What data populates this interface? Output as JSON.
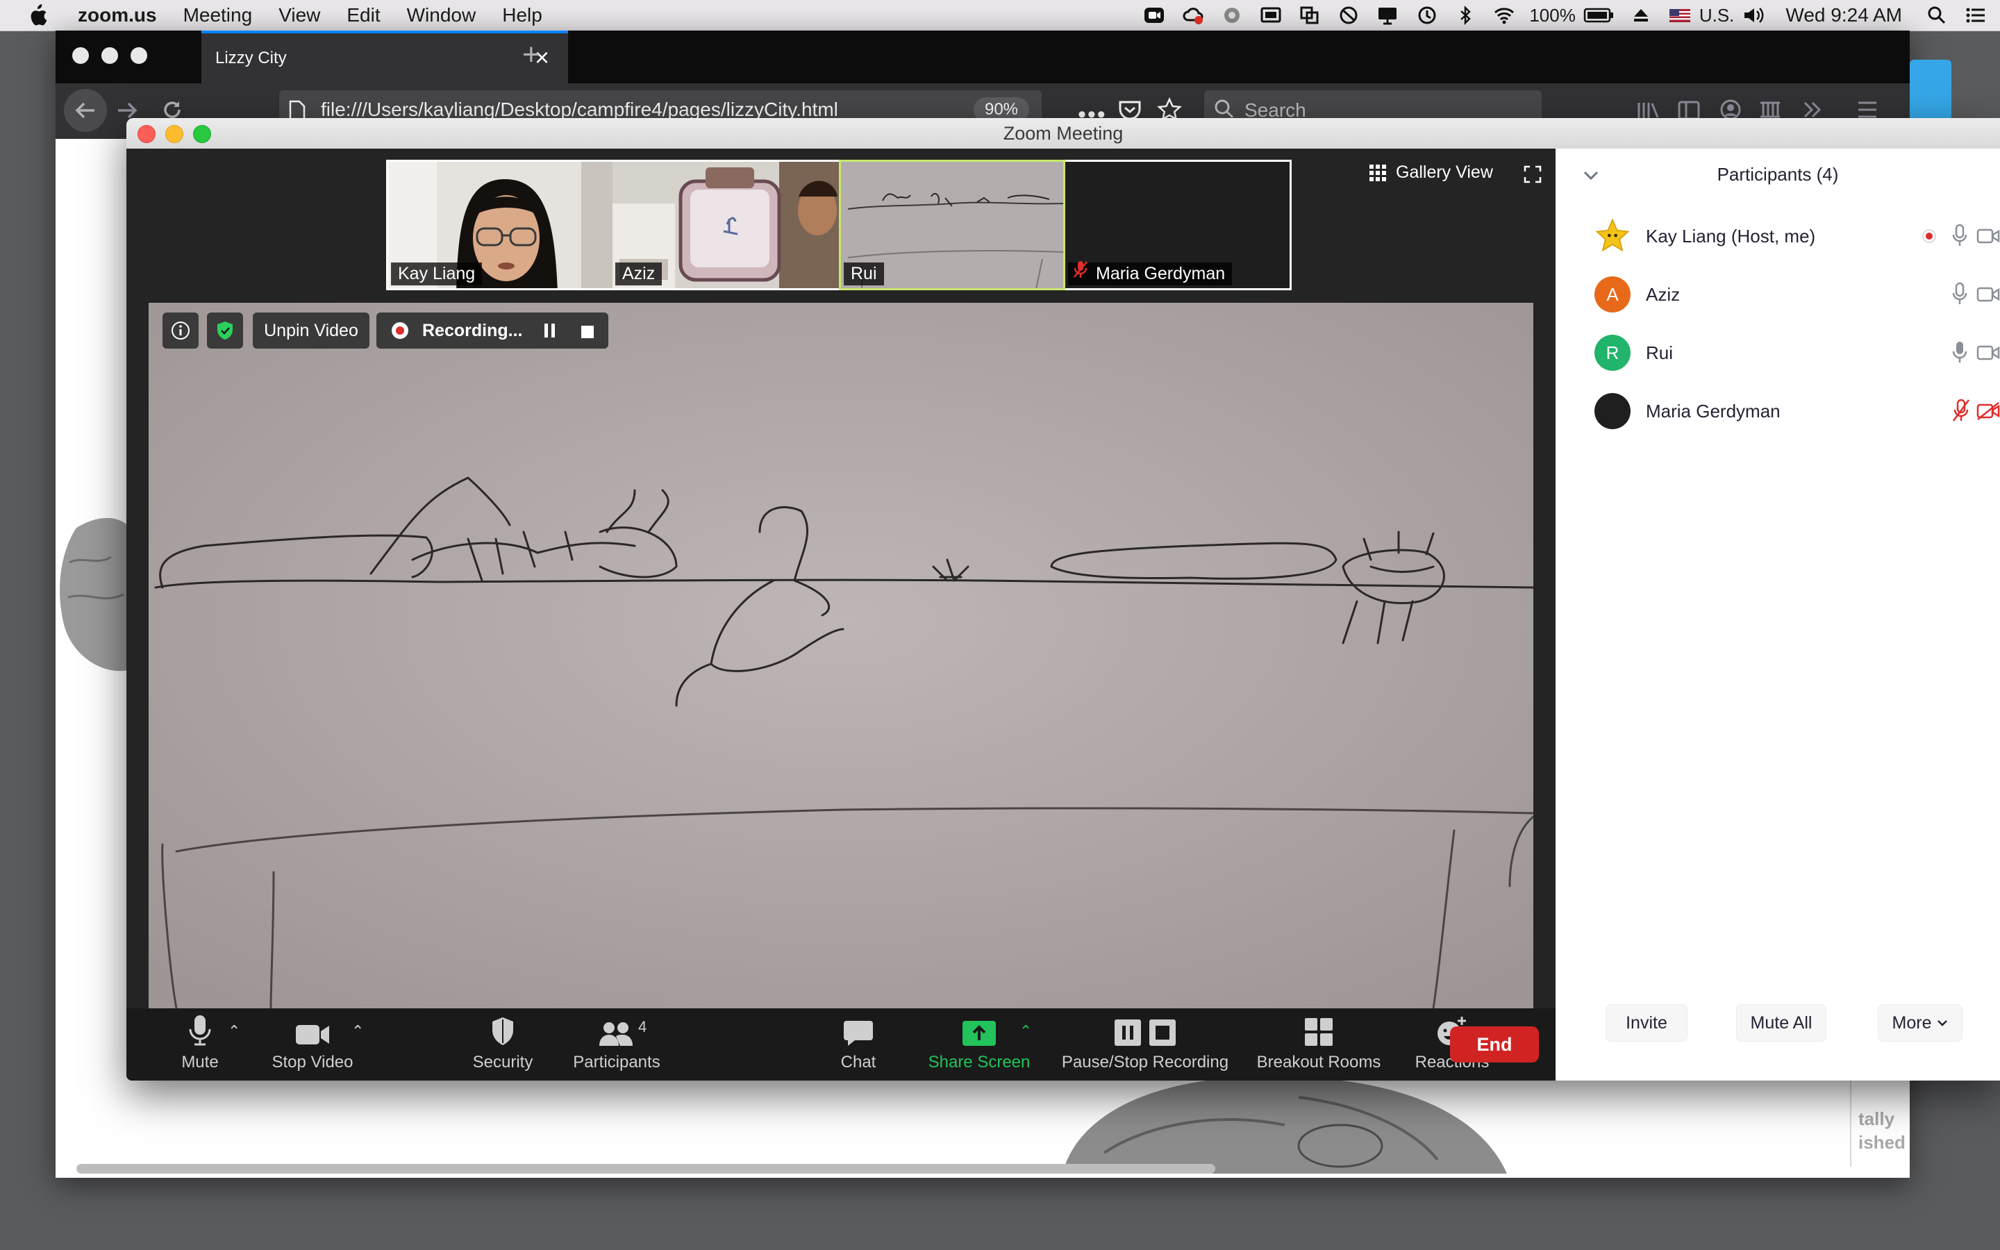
{
  "menubar": {
    "app_name": "zoom.us",
    "menus": [
      "Meeting",
      "View",
      "Edit",
      "Window",
      "Help"
    ],
    "battery": "100%",
    "input_source": "U.S.",
    "clock": "Wed 9:24 AM"
  },
  "browser": {
    "tab_title": "Lizzy City",
    "url": "file:///Users/kayliang/Desktop/campfire4/pages/lizzyCity.html",
    "zoom_level": "90%",
    "search_placeholder": "Search",
    "page_partial_text": [
      "tally",
      "ished"
    ]
  },
  "zoom": {
    "window_title": "Zoom Meeting",
    "gallery_view_label": "Gallery View",
    "thumbnails": [
      {
        "name": "Kay Liang"
      },
      {
        "name": "Aziz"
      },
      {
        "name": "Rui"
      },
      {
        "name": "Maria Gerdyman"
      }
    ],
    "overlay": {
      "unpin_label": "Unpin Video",
      "recording_label": "Recording..."
    },
    "toolbar": {
      "mute": "Mute",
      "stop_video": "Stop Video",
      "security": "Security",
      "participants": "Participants",
      "participants_count": "4",
      "chat": "Chat",
      "share_screen": "Share Screen",
      "pause_stop_recording": "Pause/Stop Recording",
      "breakout_rooms": "Breakout Rooms",
      "reactions": "Reactions",
      "end": "End"
    },
    "panel": {
      "title": "Participants (4)",
      "participants": [
        {
          "name": "Kay Liang (Host, me)",
          "avatar_letter": "",
          "avatar_color": "#f3c31a"
        },
        {
          "name": "Aziz",
          "avatar_letter": "A",
          "avatar_color": "#e8691a"
        },
        {
          "name": "Rui",
          "avatar_letter": "R",
          "avatar_color": "#21b46b"
        },
        {
          "name": "Maria Gerdyman",
          "avatar_letter": "",
          "avatar_color": "#1f1f1f"
        }
      ],
      "invite": "Invite",
      "mute_all": "Mute All",
      "more": "More"
    },
    "colors": {
      "end_red": "#d22323",
      "share_green": "#21c35a",
      "active_speaker_border": "#c8e66e"
    }
  }
}
